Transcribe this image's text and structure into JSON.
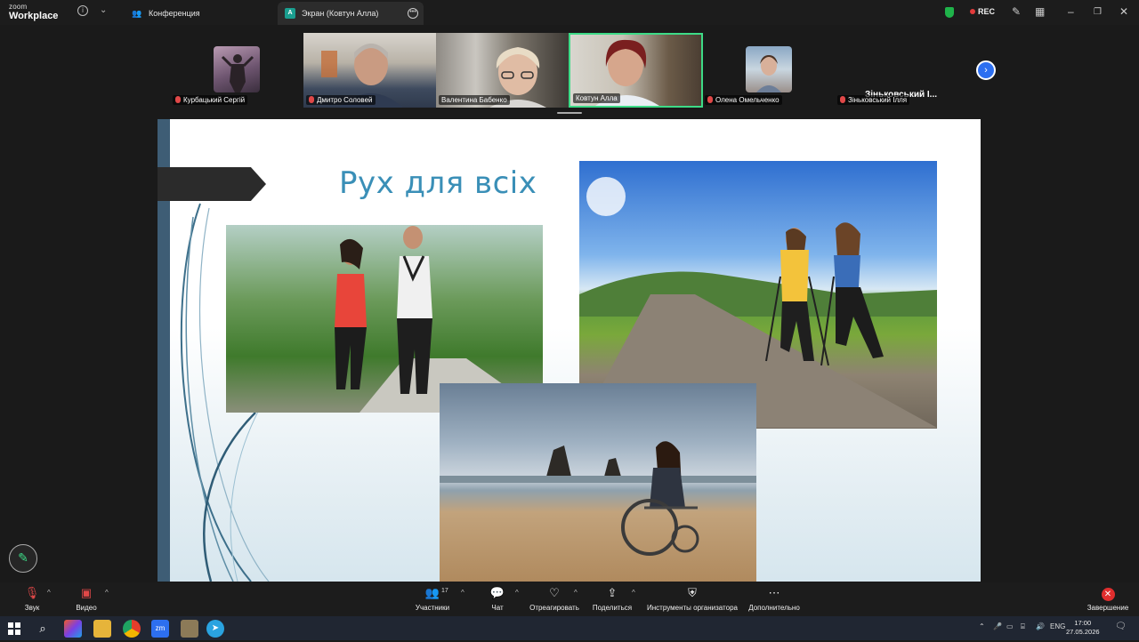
{
  "app": {
    "logo_top": "zoom",
    "logo_bottom": "Workplace"
  },
  "tabs": [
    {
      "label": "Конференция",
      "icon": "people-icon"
    },
    {
      "label": "Экран (Ковтун Алла)",
      "icon": "screen-share-badge",
      "badge": "A"
    }
  ],
  "recording": {
    "label": "REC"
  },
  "participants_strip": [
    {
      "name": "Курбацький Сергій",
      "muted": true
    },
    {
      "name": "Дмитро Соловей",
      "muted": true
    },
    {
      "name": "Валентина Бабенко",
      "muted": false
    },
    {
      "name": "Ковтун Алла",
      "muted": false,
      "active_speaker": true
    },
    {
      "name": "Олена Омельченко",
      "muted": true
    },
    {
      "name": "Зіньковський Ілля",
      "muted": true,
      "display_name_short": "Зіньковський І..."
    }
  ],
  "slide": {
    "title": "Рух для всіх",
    "colors": {
      "title": "#3a8fb7",
      "side_bar": "#3e5d75",
      "arrow": "#2b2b2b"
    }
  },
  "toolbar": {
    "audio_label": "Звук",
    "video_label": "Видео",
    "participants_label": "Участники",
    "participants_count": "17",
    "chat_label": "Чат",
    "react_label": "Отреагировать",
    "share_label": "Поделиться",
    "host_tools_label": "Инструменты организатора",
    "more_label": "Дополнительно",
    "end_label": "Завершение"
  },
  "taskbar": {
    "language": "ENG",
    "time": "17:00",
    "date": "27.05.2026"
  }
}
